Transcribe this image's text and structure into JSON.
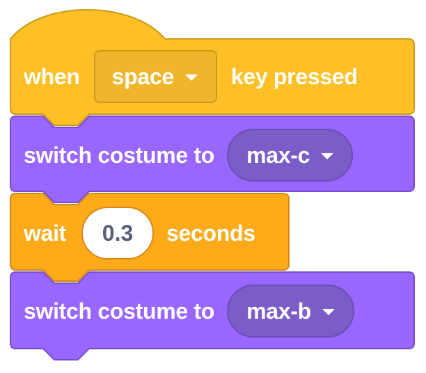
{
  "blocks": {
    "hat": {
      "label_before": "when",
      "key_value": "space",
      "label_after": "key pressed",
      "color": "#ffbf26"
    },
    "switch1": {
      "label": "switch costume to",
      "costume_value": "max-c",
      "color": "#9966ff"
    },
    "wait": {
      "label_before": "wait",
      "seconds_value": "0.3",
      "label_after": "seconds",
      "color": "#ffab19"
    },
    "switch2": {
      "label": "switch costume to",
      "costume_value": "max-b",
      "color": "#9966ff"
    }
  },
  "colors": {
    "events": "#ffbf26",
    "events_dark": "#cc9a1a",
    "looks": "#9966ff",
    "looks_dark": "#774dcb",
    "control": "#ffab19",
    "control_dark": "#cf8b17"
  },
  "icons": {
    "dropdown": "chevron-down-icon"
  }
}
